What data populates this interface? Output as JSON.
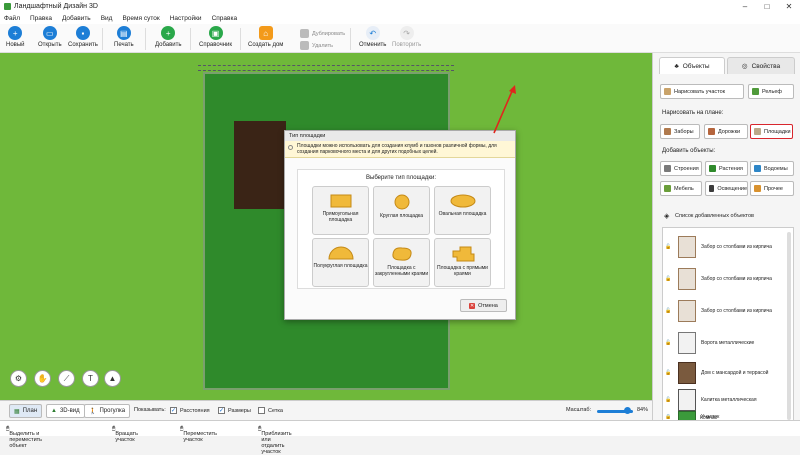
{
  "window": {
    "title": "Ландшафтный Дизайн 3D",
    "controls": [
      "–",
      "□",
      "✕"
    ]
  },
  "menu": [
    "Файл",
    "Правка",
    "Добавить",
    "Вид",
    "Время суток",
    "Настройки",
    "Справка"
  ],
  "toolbar": {
    "new": "Новый",
    "open": "Открыть",
    "save": "Сохранить",
    "print": "Печать",
    "add": "Добавить",
    "reference": "Справочник",
    "build_house": "Создать дом",
    "duplicate": "Дублировать",
    "delete": "Удалить",
    "undo": "Отменить",
    "redo": "Повторить"
  },
  "dialog": {
    "title": "Тип площадки",
    "info": "Площадки можно использовать для создания клумб и газонов различной формы, для создания парковочного места и для других подобных целей.",
    "prompt": "Выберите тип площадки:",
    "shapes": [
      "Прямоугольная площадка",
      "Круглая площадка",
      "Овальная площадка",
      "Полукруглая площадка",
      "Площадка с закругленными краями",
      "Площадка с прямыми краями"
    ],
    "cancel": "Отмена"
  },
  "panel": {
    "tabs": [
      "Объекты",
      "Свойства"
    ],
    "draw_site": "Нарисовать участок",
    "relief": "Рельеф",
    "draw_on_plan": "Нарисовать на плане:",
    "fences": "Заборы",
    "paths": "Дорожки",
    "areas": "Площадки",
    "add_objects": "Добавить объекты:",
    "buildings": "Строения",
    "plants": "Растения",
    "water": "Водоемы",
    "furniture": "Мебель",
    "lighting": "Освещение",
    "other": "Прочее",
    "list_title": "Список добавленных объектов",
    "objects": [
      "Забор со столбами из кирпича",
      "Забор со столбами из кирпича",
      "Забор со столбами из кирпича",
      "Ворота металлические",
      "Дом с мансардой и террасой",
      "Калитка металлическая",
      "Участок",
      "Компас"
    ]
  },
  "status": {
    "plan": "План",
    "view3d": "3D-вид",
    "walk": "Прогулка",
    "show": "Показывать:",
    "distances": "Расстояния",
    "sizes": "Размеры",
    "grid": "Сетка",
    "scale": "Масштаб:",
    "zoom": "84%"
  },
  "hints": [
    "Выделить и переместить объект",
    "Вращать участок",
    "Переместить участок",
    "Приблизить или отдалить участок"
  ]
}
